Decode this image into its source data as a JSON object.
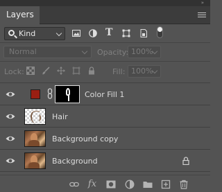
{
  "panel": {
    "tab_label": "Layers",
    "collapse_glyph": "»"
  },
  "filter": {
    "kind_label": "Kind",
    "filter_icons": [
      "image-filter-icon",
      "adjustment-filter-icon",
      "type-filter-icon",
      "shape-filter-icon",
      "smart-object-filter-icon"
    ],
    "type_glyph": "T"
  },
  "blend": {
    "mode": "Normal",
    "opacity_label": "Opacity:",
    "opacity_value": "100%"
  },
  "locks": {
    "lock_label": "Lock:",
    "fill_label": "Fill:",
    "fill_value": "100%"
  },
  "layers": [
    {
      "name": "Color Fill 1",
      "type": "fill",
      "fill_color": "#9a1f12",
      "visible": true
    },
    {
      "name": "Hair",
      "type": "pixel",
      "visible": true
    },
    {
      "name": "Background copy",
      "type": "pixel",
      "visible": true
    },
    {
      "name": "Background",
      "type": "pixel",
      "locked": true,
      "visible": true
    }
  ],
  "footer": {
    "fx_label": "fx"
  },
  "colors": {
    "panel_bg": "#535353",
    "tab_bar_bg": "#3c3c3c",
    "fill_swatch": "#9a1f12"
  }
}
